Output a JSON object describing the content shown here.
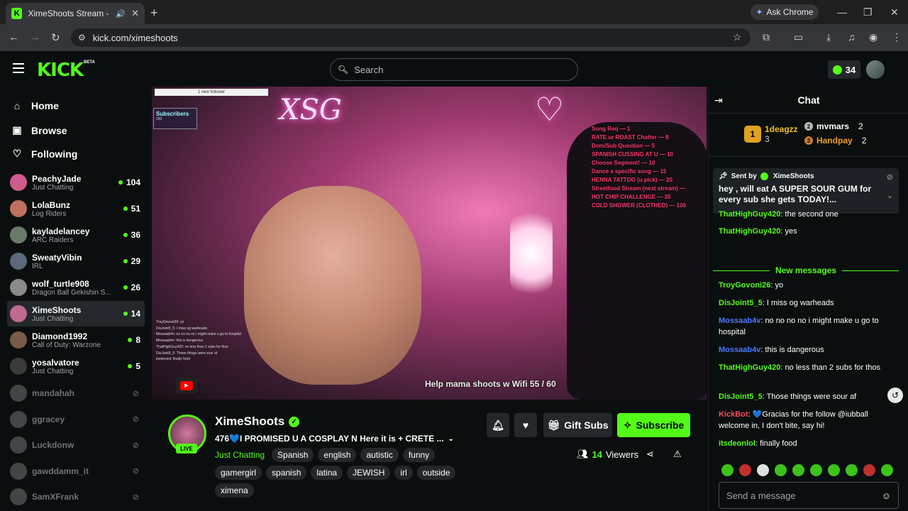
{
  "browser": {
    "tab_title": "XimeShoots Stream - Watch",
    "url": "kick.com/ximeshoots",
    "ask_chrome": "Ask Chrome"
  },
  "header": {
    "logo": "KICK",
    "beta": "BETA",
    "search_placeholder": "Search",
    "kicks_count": "34"
  },
  "sidebar": {
    "nav": [
      {
        "label": "Home",
        "icon": "home-icon"
      },
      {
        "label": "Browse",
        "icon": "browse-icon"
      },
      {
        "label": "Following",
        "icon": "heart-icon"
      }
    ],
    "channels": [
      {
        "name": "PeachyJade",
        "category": "Just Chatting",
        "viewers": "104",
        "color": "#d05a8a"
      },
      {
        "name": "LolaBunz",
        "category": "Log Riders",
        "viewers": "51",
        "color": "#c07060"
      },
      {
        "name": "kayladelancey",
        "category": "ARC Raiders",
        "viewers": "36",
        "color": "#6a7a6a"
      },
      {
        "name": "SweatyVibin",
        "category": "IRL",
        "viewers": "29",
        "color": "#5a6a7a"
      },
      {
        "name": "wolf_turtle908",
        "category": "Dragon Ball Gekishin S...",
        "viewers": "26",
        "color": "#8a8a8a"
      },
      {
        "name": "XimeShoots",
        "category": "Just Chatting",
        "viewers": "14",
        "color": "#c06a90"
      },
      {
        "name": "Diamond1992",
        "category": "Call of Duty: Warzone",
        "viewers": "8",
        "color": "#7a5a4a"
      },
      {
        "name": "yosalvatore",
        "category": "Just Chatting",
        "viewers": "5",
        "color": "#3a3a3a"
      }
    ],
    "offline": [
      "mandahah",
      "ggracey",
      "Luckdonw",
      "gawddamm_it",
      "SamXFrank"
    ]
  },
  "video": {
    "new_follower": "1 new follower",
    "subscribers_title": "Subscribers",
    "subscribers_count": "180",
    "menu": [
      "Song Req — 1",
      "RATE ur ROAST Chatter — 8",
      "Dom/Sub Question — 5",
      "SPANISH CUSSING AT U — 10",
      "Choose Segment! — 10",
      "Dance a specific song — 15",
      "HENNA TATTOO (u pick) — 20",
      "Streetfood Stream (next stream) —",
      "HOT CHIP CHALLENGE — 35",
      "COLD SHOWER (CLOTHED) — 100"
    ],
    "overlay_chat": [
      "TroyGovoni26: yo",
      "DisJoint5_5: I miss og warheads",
      "Mossaab4v: no no no no i might make u go to hospital",
      "Mossaab4v: this is dangerous",
      "ThatHighGuy420: no less than 2 subs for thos",
      "DisJoint5_5: Those things were sour af",
      "itsdeonlol: finally food"
    ],
    "wifi_goal": "Help mama shoots w Wifi  55 / 60"
  },
  "stream": {
    "name": "XimeShoots",
    "live": "LIVE",
    "title": "476💙I PROMISED U A COSPLAY N Here it is + CRETE ...",
    "category": "Just Chatting",
    "tags": [
      "Spanish",
      "english",
      "autistic",
      "funny",
      "gamergirl",
      "spanish",
      "latina",
      "JEWISH",
      "irl",
      "outside",
      "ximena"
    ],
    "gift_subs": "Gift Subs",
    "subscribe": "Subscribe",
    "viewers_count": "14",
    "viewers_label": "Viewers"
  },
  "chat": {
    "title": "Chat",
    "leaderboard": [
      {
        "rank": "1",
        "name": "1deagzz",
        "count": "3"
      },
      {
        "rank": "2",
        "name": "mvmars",
        "count": "2"
      },
      {
        "rank": "3",
        "name": "Handpay",
        "count": "2"
      }
    ],
    "pinned_sent_by": "Sent by",
    "pinned_author": "XimeShoots",
    "pinned_text": "hey , will eat A SUPER SOUR GUM for every sub she gets TODAY!...",
    "messages_before": [
      {
        "user": "ThatHighGuy420",
        "text": "the second one",
        "color": "#53fc18"
      },
      {
        "user": "ThatHighGuy420",
        "text": "yes",
        "color": "#53fc18"
      }
    ],
    "new_messages_label": "New messages",
    "messages": [
      {
        "user": "TroyGovoni26",
        "text": "yo",
        "color": "#53fc18"
      },
      {
        "user": "DisJoint5_5",
        "text": "I miss og warheads",
        "color": "#53fc18"
      },
      {
        "user": "Mossaab4v",
        "text": "no no no no i might make u go to hospital",
        "color": "#4a7aff"
      },
      {
        "user": "Mossaab4v",
        "text": "this is dangerous",
        "color": "#4a7aff"
      },
      {
        "user": "ThatHighGuy420",
        "text": "no less than 2 subs for thos",
        "color": "#53fc18"
      },
      {
        "user": "DisJoint5_5",
        "text": "Those things were sour af",
        "color": "#53fc18"
      },
      {
        "user": "KickBot",
        "text": "💙Gracias for the follow @iubball welcome in, I don't bite, say hi!",
        "color": "#ff4a5a"
      },
      {
        "user": "itsdeonlol",
        "text": "finally food",
        "color": "#53fc18"
      }
    ],
    "input_placeholder": "Send a message"
  },
  "colors": {
    "accent": "#53fc18",
    "bg": "#0b0e0f",
    "surface": "#24272c"
  }
}
